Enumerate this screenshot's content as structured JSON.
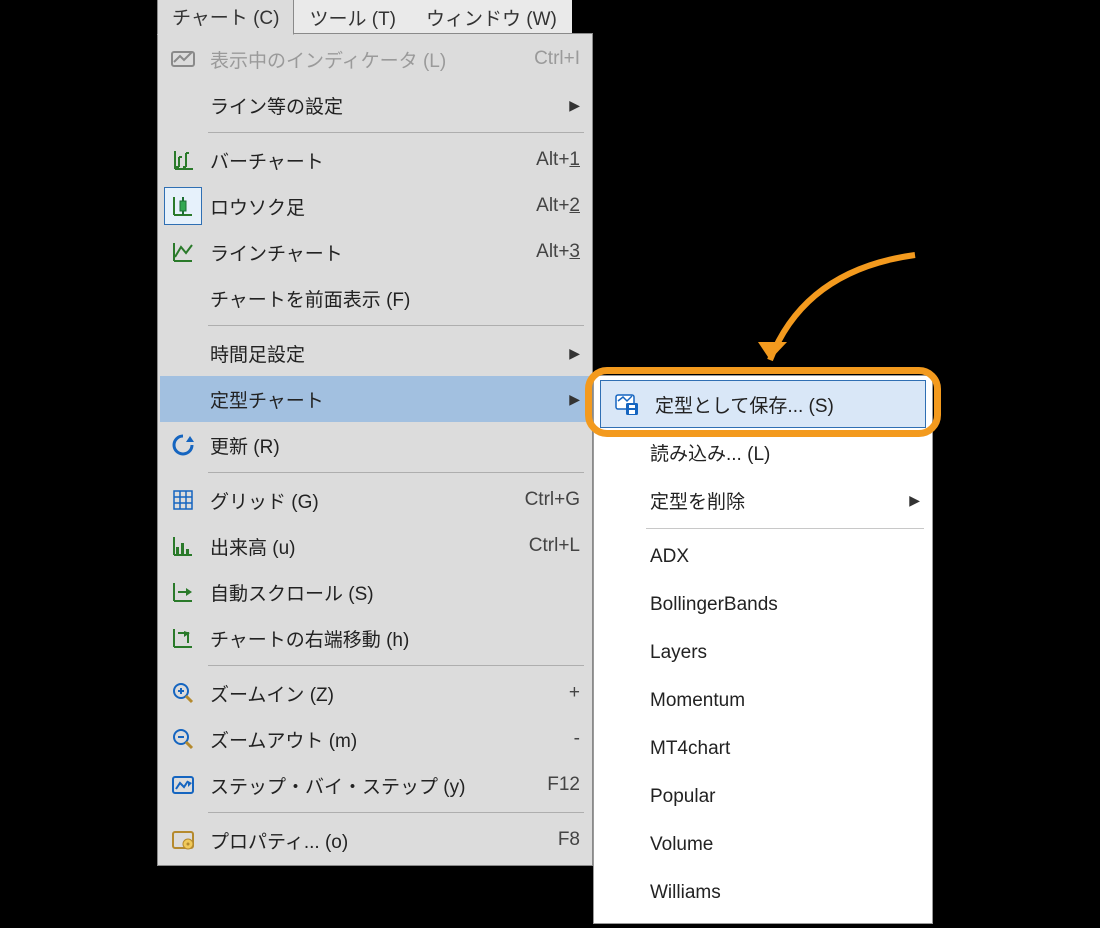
{
  "menubar": {
    "tabs": [
      {
        "label": "チャート (C)",
        "active": true
      },
      {
        "label": "ツール (T)",
        "active": false
      },
      {
        "label": "ウィンドウ (W)",
        "active": false
      }
    ]
  },
  "dropdown": {
    "items": [
      {
        "kind": "item",
        "icon": "indicator-icon",
        "label": "表示中のインディケータ (L)",
        "shortcut": "Ctrl+I",
        "hasSub": false,
        "disabled": true
      },
      {
        "kind": "item",
        "icon": "",
        "label": "ライン等の設定",
        "shortcut": "",
        "hasSub": true
      },
      {
        "kind": "sep"
      },
      {
        "kind": "item",
        "icon": "bar-chart-icon",
        "label": "バーチャート",
        "shortcut": "Alt+1",
        "hasSub": false,
        "ulLast": true
      },
      {
        "kind": "item",
        "icon": "candle-chart-icon",
        "label": "ロウソク足",
        "shortcut": "Alt+2",
        "hasSub": false,
        "framed": true,
        "ulLast": true
      },
      {
        "kind": "item",
        "icon": "line-chart-icon",
        "label": "ラインチャート",
        "shortcut": "Alt+3",
        "hasSub": false,
        "ulLast": true
      },
      {
        "kind": "item",
        "icon": "",
        "label": "チャートを前面表示 (F)",
        "shortcut": "",
        "hasSub": false
      },
      {
        "kind": "sep"
      },
      {
        "kind": "item",
        "icon": "",
        "label": "時間足設定",
        "shortcut": "",
        "hasSub": true
      },
      {
        "kind": "item",
        "icon": "",
        "label": "定型チャート",
        "shortcut": "",
        "hasSub": true,
        "highlight": true
      },
      {
        "kind": "item",
        "icon": "refresh-icon",
        "label": "更新 (R)",
        "shortcut": "",
        "hasSub": false
      },
      {
        "kind": "sep"
      },
      {
        "kind": "item",
        "icon": "grid-icon",
        "label": "グリッド (G)",
        "shortcut": "Ctrl+G",
        "hasSub": false
      },
      {
        "kind": "item",
        "icon": "volume-icon",
        "label": "出来高 (u)",
        "shortcut": "Ctrl+L",
        "hasSub": false
      },
      {
        "kind": "item",
        "icon": "autoscroll-icon",
        "label": "自動スクロール (S)",
        "shortcut": "",
        "hasSub": false
      },
      {
        "kind": "item",
        "icon": "shift-icon",
        "label": "チャートの右端移動 (h)",
        "shortcut": "",
        "hasSub": false
      },
      {
        "kind": "sep"
      },
      {
        "kind": "item",
        "icon": "zoom-in-icon",
        "label": "ズームイン (Z)",
        "shortcut": "+",
        "hasSub": false
      },
      {
        "kind": "item",
        "icon": "zoom-out-icon",
        "label": "ズームアウト (m)",
        "shortcut": "-",
        "hasSub": false
      },
      {
        "kind": "item",
        "icon": "step-icon",
        "label": "ステップ・バイ・ステップ (y)",
        "shortcut": "F12",
        "hasSub": false
      },
      {
        "kind": "sep"
      },
      {
        "kind": "item",
        "icon": "properties-icon",
        "label": "プロパティ... (o)",
        "shortcut": "F8",
        "hasSub": false
      }
    ]
  },
  "submenu": {
    "items": [
      {
        "kind": "item",
        "icon": "save-template-icon",
        "label": "定型として保存... (S)",
        "highlight": true
      },
      {
        "kind": "item",
        "icon": "",
        "label": "読み込み... (L)"
      },
      {
        "kind": "item",
        "icon": "",
        "label": "定型を削除",
        "hasSub": true
      },
      {
        "kind": "sep"
      },
      {
        "kind": "item",
        "icon": "",
        "label": "ADX"
      },
      {
        "kind": "item",
        "icon": "",
        "label": "BollingerBands"
      },
      {
        "kind": "item",
        "icon": "",
        "label": "Layers"
      },
      {
        "kind": "item",
        "icon": "",
        "label": "Momentum"
      },
      {
        "kind": "item",
        "icon": "",
        "label": "MT4chart"
      },
      {
        "kind": "item",
        "icon": "",
        "label": "Popular"
      },
      {
        "kind": "item",
        "icon": "",
        "label": "Volume"
      },
      {
        "kind": "item",
        "icon": "",
        "label": "Williams"
      }
    ]
  }
}
